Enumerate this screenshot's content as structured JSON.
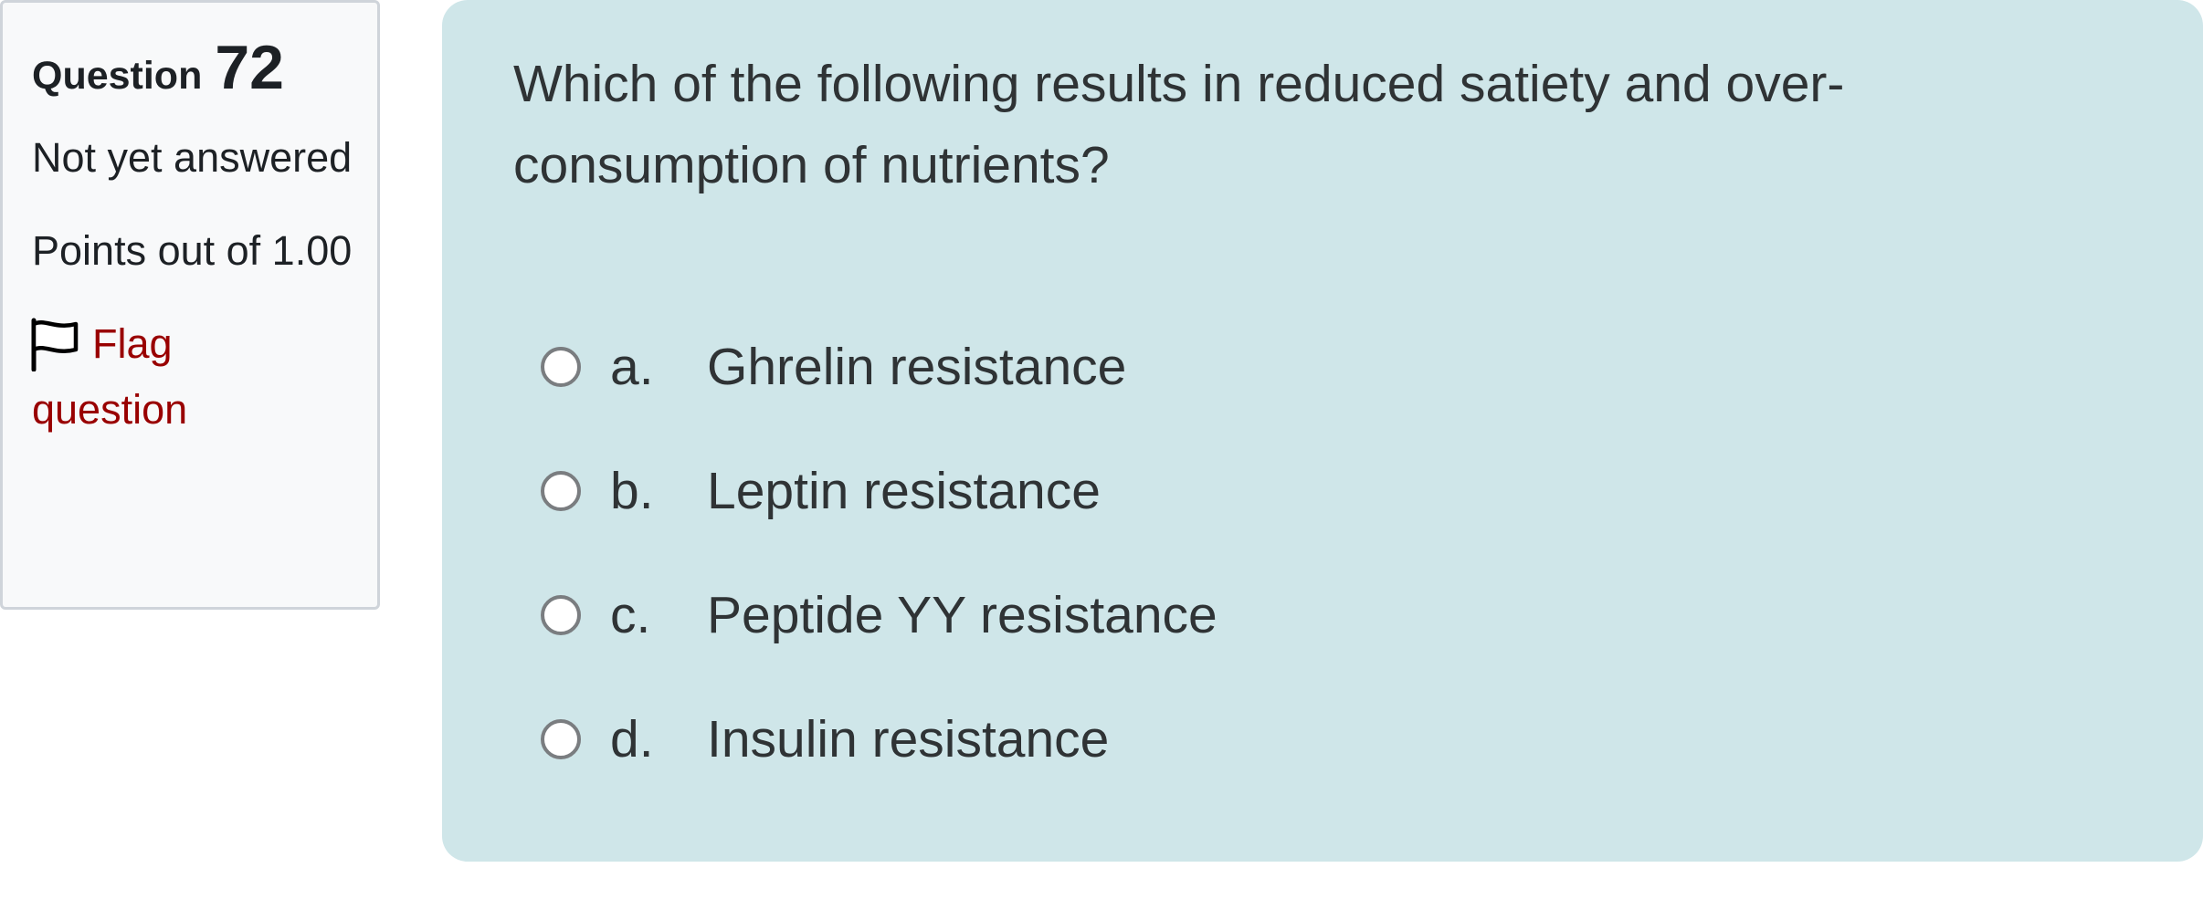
{
  "question_info": {
    "label": "Question",
    "number": "72",
    "state": "Not yet answered",
    "grade": "Points out of 1.00",
    "flag_label": "Flag question",
    "flag_color": "#990000"
  },
  "question": {
    "text": "Which of the following results in reduced satiety and over-consumption of nutrients?",
    "background_color": "#cfe6e9",
    "answers": [
      {
        "letter": "a.",
        "text": "Ghrelin resistance",
        "selected": false
      },
      {
        "letter": "b.",
        "text": "Leptin resistance",
        "selected": false
      },
      {
        "letter": "c.",
        "text": "Peptide YY resistance",
        "selected": false
      },
      {
        "letter": "d.",
        "text": "Insulin resistance",
        "selected": false
      }
    ]
  }
}
